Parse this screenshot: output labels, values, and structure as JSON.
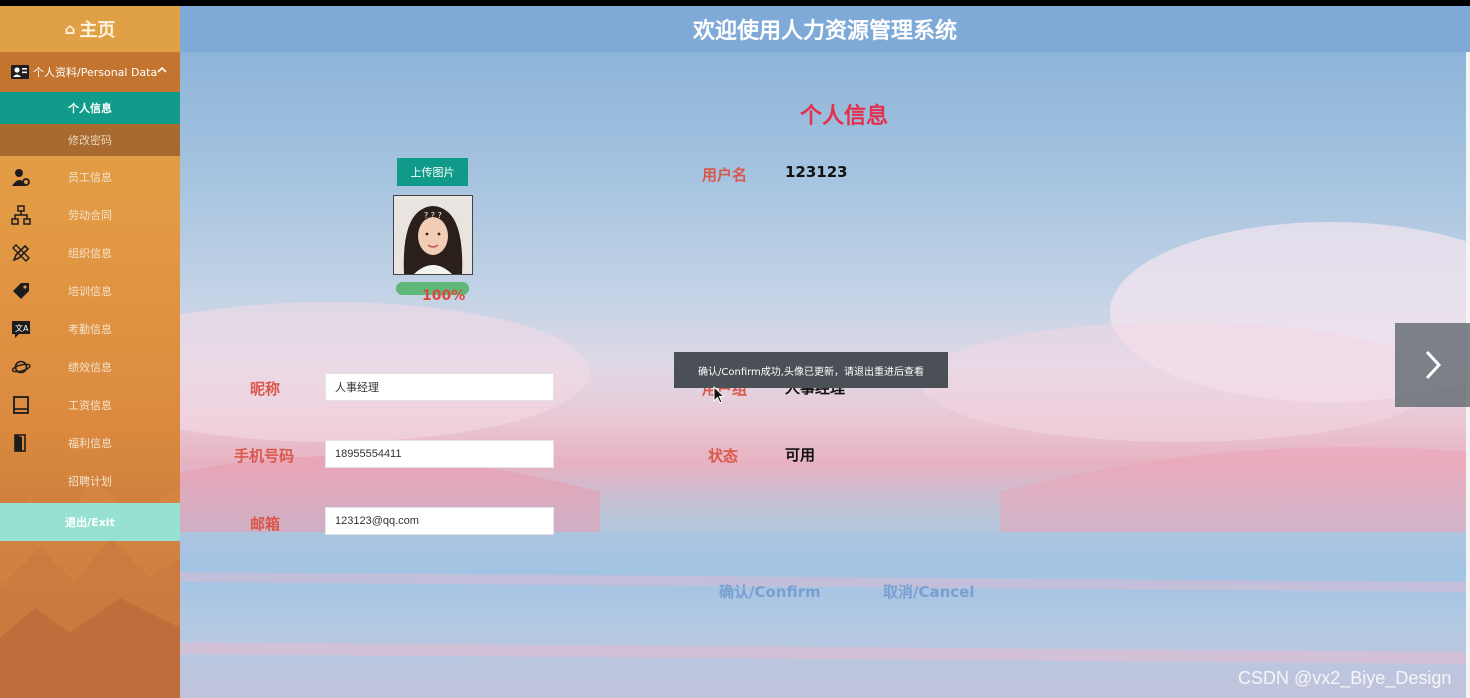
{
  "sidebar": {
    "home_label": "主页",
    "group": {
      "label": "个人资料/Personal Data"
    },
    "subitems": [
      {
        "label": "个人信息",
        "active": true
      },
      {
        "label": "修改密码",
        "active": false
      }
    ],
    "nav": [
      {
        "label": "员工信息",
        "icon": "employee-gear-icon"
      },
      {
        "label": "劳动合同",
        "icon": "org-tree-icon"
      },
      {
        "label": "组织信息",
        "icon": "pencil-ruler-icon"
      },
      {
        "label": "培训信息",
        "icon": "tag-icon"
      },
      {
        "label": "考勤信息",
        "icon": "translate-chat-icon"
      },
      {
        "label": "绩效信息",
        "icon": "planet-icon"
      },
      {
        "label": "工资信息",
        "icon": "book-icon"
      },
      {
        "label": "福利信息",
        "icon": "door-icon"
      },
      {
        "label": "招聘计划",
        "icon": ""
      }
    ],
    "exit_label": "退出/Exit"
  },
  "header": {
    "title": "欢迎使用人力资源管理系统"
  },
  "profile": {
    "title": "个人信息",
    "upload_label": "上传图片",
    "progress_percent": 100,
    "progress_text": "100%",
    "fields": {
      "username": {
        "label": "用户名",
        "value": "123123"
      },
      "nickname": {
        "label": "昵称",
        "value": "人事经理"
      },
      "usergroup": {
        "label": "用户组",
        "value": "人事经理"
      },
      "phone": {
        "label": "手机号码",
        "value": "18955554411"
      },
      "status": {
        "label": "状态",
        "value": "可用"
      },
      "email": {
        "label": "邮箱",
        "value": "123123@qq.com"
      }
    },
    "confirm_label": "确认/Confirm",
    "cancel_label": "取消/Cancel"
  },
  "toast": {
    "message": "确认/Confirm成功,头像已更新，请退出重进后查看"
  },
  "watermark": "CSDN @vx2_Biye_Design",
  "colors": {
    "accent_teal": "#0f9a89",
    "title_red": "#e5304d",
    "label_red": "#d9584b",
    "header_blue": "#7fa9d6",
    "sidebar_orange": "#e39a44"
  }
}
